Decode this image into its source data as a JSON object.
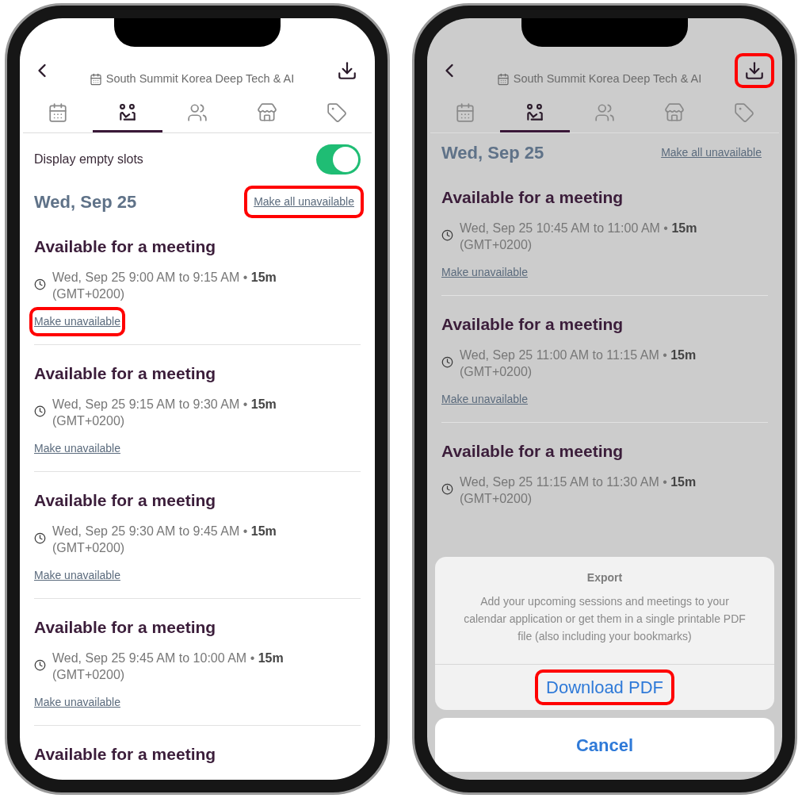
{
  "phones": [
    {
      "header": {
        "subtitle": "South Summit Korea Deep Tech & AI",
        "download_highlighted": false
      },
      "tabs": [
        {
          "kind": "calendar",
          "selected": false
        },
        {
          "kind": "meetings",
          "selected": true
        },
        {
          "kind": "people",
          "selected": false
        },
        {
          "kind": "store",
          "selected": false
        },
        {
          "kind": "tag",
          "selected": false
        }
      ],
      "toggle": {
        "label": "Display empty slots",
        "on": true
      },
      "day": {
        "date": "Wed, Sep 25",
        "action": "Make all unavailable",
        "highlighted": true
      },
      "slots": [
        {
          "title": "Available for a meeting",
          "time": "Wed, Sep 25 9:00 AM to 9:15 AM • **15m**",
          "timezone": "(GMT+0200)",
          "action": "Make unavailable",
          "highlighted": true
        },
        {
          "title": "Available for a meeting",
          "time": "Wed, Sep 25 9:15 AM to 9:30 AM • **15m**",
          "timezone": "(GMT+0200)",
          "action": "Make unavailable",
          "highlighted": false
        },
        {
          "title": "Available for a meeting",
          "time": "Wed, Sep 25 9:30 AM to 9:45 AM • **15m**",
          "timezone": "(GMT+0200)",
          "action": "Make unavailable",
          "highlighted": false
        },
        {
          "title": "Available for a meeting",
          "time": "Wed, Sep 25 9:45 AM to 10:00 AM • **15m**",
          "timezone": "(GMT+0200)",
          "action": "Make unavailable",
          "highlighted": false
        },
        {
          "title": "Available for a meeting"
        }
      ]
    },
    {
      "header": {
        "subtitle": "South Summit Korea Deep Tech & AI",
        "download_highlighted": true
      },
      "tabs": [
        {
          "kind": "calendar",
          "selected": false
        },
        {
          "kind": "meetings",
          "selected": true
        },
        {
          "kind": "people",
          "selected": false
        },
        {
          "kind": "store",
          "selected": false
        },
        {
          "kind": "tag",
          "selected": false
        }
      ],
      "day": {
        "date": "Wed, Sep 25",
        "action": "Make all unavailable",
        "highlighted": false
      },
      "slots": [
        {
          "title": "Available for a meeting",
          "time": "Wed, Sep 25 10:45 AM to 11:00 AM • **15m**",
          "timezone": "(GMT+0200)",
          "action": "Make unavailable",
          "highlighted": false
        },
        {
          "title": "Available for a meeting",
          "time": "Wed, Sep 25 11:00 AM to 11:15 AM • **15m**",
          "timezone": "(GMT+0200)",
          "action": "Make unavailable",
          "highlighted": false
        },
        {
          "title": "Available for a meeting",
          "time": "Wed, Sep 25 11:15 AM to 11:30 AM • **15m**",
          "timezone": "(GMT+0200)"
        }
      ],
      "sheet": {
        "title": "Export",
        "message": "Add your upcoming sessions and meetings to your calendar application or get them in a single printable PDF file (also including your bookmarks)",
        "action": "Download PDF",
        "action_highlighted": true,
        "cancel": "Cancel"
      }
    }
  ]
}
